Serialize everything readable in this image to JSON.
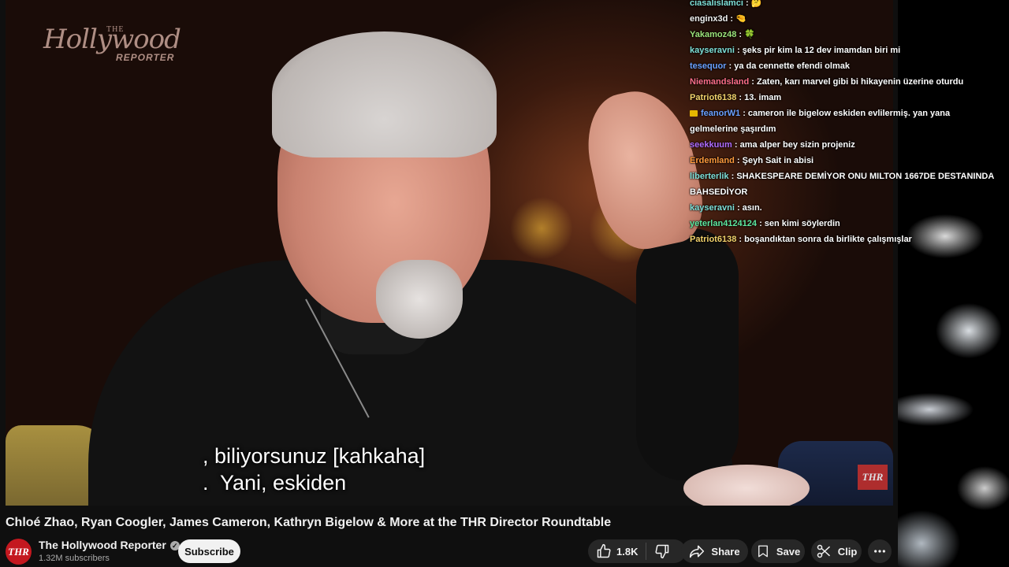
{
  "video": {
    "watermark": {
      "the": "THE",
      "main": "Hollywood",
      "sub": "REPORTER"
    },
    "captions": [
      ", biliyorsunuz [kahkaha]",
      ".  Yani, eskiden"
    ],
    "corner_badge": "THR"
  },
  "chat": {
    "messages": [
      {
        "user": "ciasalislamci",
        "text": ": 🤔",
        "color": "#7fe0d8"
      },
      {
        "user": "enginx3d",
        "text": ": 🤏",
        "color": "#f1f1f1"
      },
      {
        "user": "Yakamoz48",
        "text": ": 🍀",
        "color": "#9be37a"
      },
      {
        "user": "kayseravni",
        "text": ": şeks pir kim la 12 dev imamdan biri mi",
        "color": "#7fe0d8"
      },
      {
        "user": "tesequor",
        "text": ": ya da cennette efendi olmak",
        "color": "#6aa0ff"
      },
      {
        "user": "Niemandsland",
        "text": ": Zaten, karı marvel gibi bi hikayenin üzerine oturdu",
        "color": "#ff6f8a"
      },
      {
        "user": "Patriot6138",
        "text": ": 13. imam",
        "color": "#f3d36c"
      },
      {
        "user": "feanorW1",
        "text": ": cameron ile bigelow eskiden evlilermiş. yan yana gelmelerine şaşırdım",
        "color": "#6aa0ff",
        "badge": true
      },
      {
        "user": "seekkuum",
        "text": ": ama alper bey sizin projeniz",
        "color": "#b06cff"
      },
      {
        "user": "Erdemland",
        "text": ": Şeyh Sait in abisi",
        "color": "#ff9a3c"
      },
      {
        "user": "liberterlik",
        "text": ": SHAKESPEARE DEMİYOR ONU MILTON 1667DE DESTANINDA BAHSEDİYOR",
        "color": "#7fe0d8"
      },
      {
        "user": "kayseravni",
        "text": ": asın.",
        "color": "#7fe0d8"
      },
      {
        "user": "yeterlan4124124",
        "text": ": sen kimi söylerdin",
        "color": "#5fe8a0"
      },
      {
        "user": "Patriot6138",
        "text": ": boşandıktan sonra da birlikte çalışmışlar",
        "color": "#f3d36c"
      }
    ]
  },
  "title": "Chloé Zhao, Ryan Coogler, James Cameron, Kathryn Bigelow & More at the THR Director Roundtable",
  "channel": {
    "avatar_text": "THR",
    "name": "The Hollywood Reporter",
    "subscribers": "1.32M subscribers",
    "subscribe_label": "Subscribe"
  },
  "actions": {
    "like_count": "1.8K",
    "share_label": "Share",
    "save_label": "Save",
    "clip_label": "Clip"
  }
}
